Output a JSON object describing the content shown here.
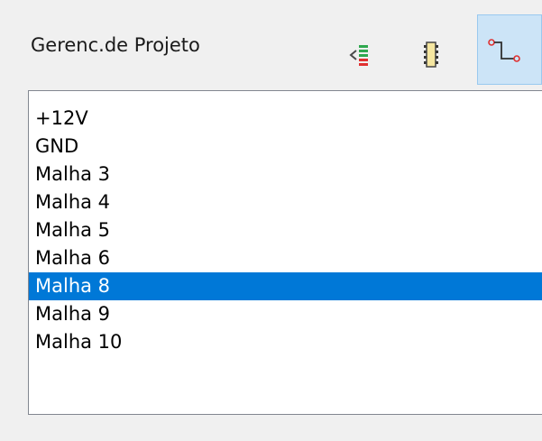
{
  "panel": {
    "title": "Gerenc.de Projeto"
  },
  "toolbar": {
    "buttons": [
      {
        "icon": "list-order-icon",
        "active": false
      },
      {
        "icon": "component-chip-icon",
        "active": false
      },
      {
        "icon": "net-wire-icon",
        "active": true
      }
    ]
  },
  "nets": {
    "items": [
      {
        "label": "+12V"
      },
      {
        "label": "GND"
      },
      {
        "label": "Malha 3"
      },
      {
        "label": "Malha 4"
      },
      {
        "label": "Malha 5"
      },
      {
        "label": "Malha 6"
      },
      {
        "label": "Malha 8",
        "selected": true
      },
      {
        "label": "Malha 9"
      },
      {
        "label": "Malha 10"
      }
    ]
  },
  "colors": {
    "selection": "#0078d7",
    "active_button": "#cce4f7",
    "icon_red": "#e03030",
    "icon_green": "#2fa84f"
  }
}
